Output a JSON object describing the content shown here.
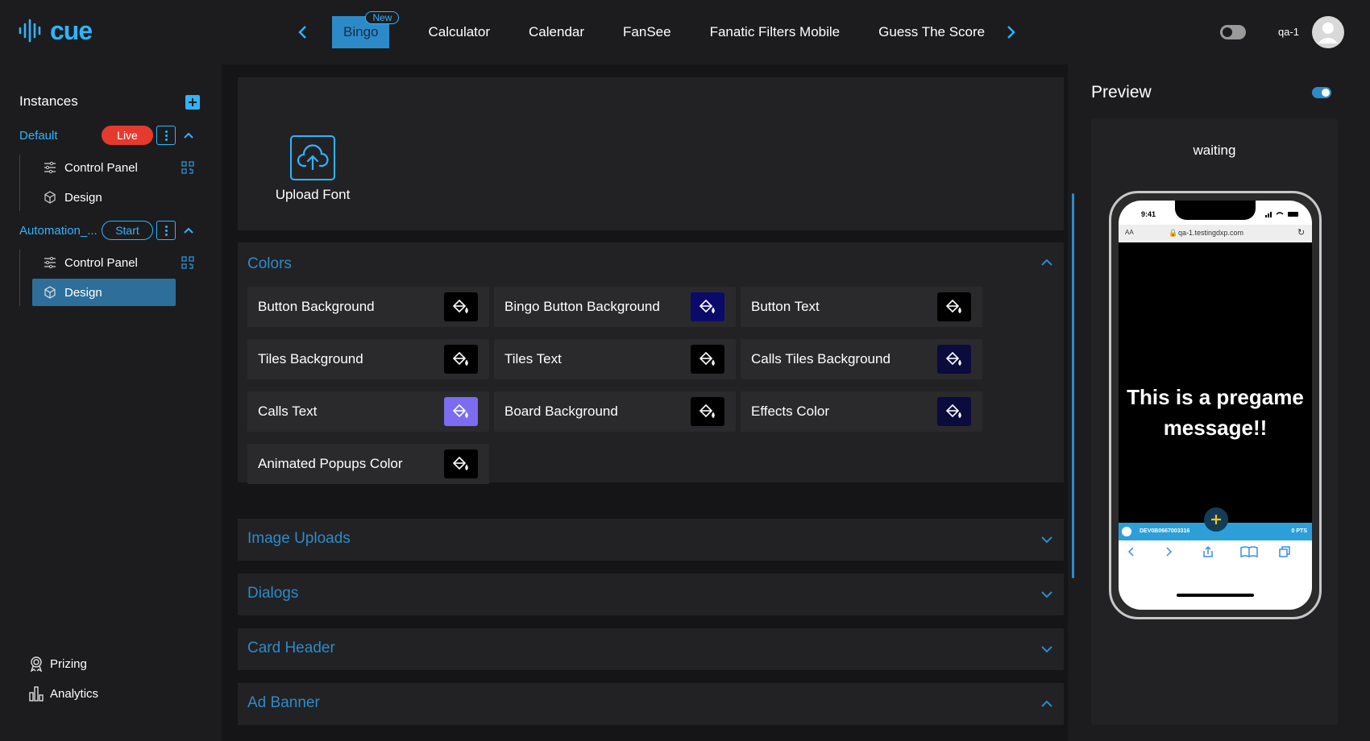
{
  "header": {
    "logo_text": "cue",
    "tabs": [
      {
        "label": "Bingo",
        "badge": "New",
        "active": true
      },
      {
        "label": "Calculator"
      },
      {
        "label": "Calendar"
      },
      {
        "label": "FanSee"
      },
      {
        "label": "Fanatic Filters Mobile"
      },
      {
        "label": "Guess The Score"
      }
    ],
    "username": "qa-1"
  },
  "sidebar": {
    "title": "Instances",
    "instances": [
      {
        "name": "Default",
        "status": "Live",
        "items": [
          "Control Panel",
          "Design"
        ]
      },
      {
        "name": "Automation_...",
        "status": "Start",
        "items": [
          "Control Panel",
          "Design"
        ]
      }
    ],
    "bottom": [
      "Prizing",
      "Analytics"
    ]
  },
  "upload": {
    "label": "Upload Font"
  },
  "colors": {
    "title": "Colors",
    "items": [
      {
        "label": "Button Background",
        "color": "#000000"
      },
      {
        "label": "Bingo Button Background",
        "color": "#0a0a6b"
      },
      {
        "label": "Button Text",
        "color": "#000000"
      },
      {
        "label": "Tiles Background",
        "color": "#000000"
      },
      {
        "label": "Tiles Text",
        "color": "#000000"
      },
      {
        "label": "Calls Tiles Background",
        "color": "#0b0b3d"
      },
      {
        "label": "Calls Text",
        "color": "#7b6cf0"
      },
      {
        "label": "Board Background",
        "color": "#000000"
      },
      {
        "label": "Effects Color",
        "color": "#0b0b3d"
      },
      {
        "label": "Animated Popups Color",
        "color": "#000000"
      }
    ]
  },
  "sections": [
    "Image Uploads",
    "Dialogs",
    "Card Header",
    "Ad Banner"
  ],
  "preview": {
    "title": "Preview",
    "status": "waiting",
    "phone_time": "9:41",
    "url_prefix": "AA",
    "url": "qa-1.testingdxp.com",
    "message": "This is a pregame message!!",
    "user_id": "DEV0B0667003316",
    "points": "0 PTS"
  },
  "theme": {
    "accent": "#2fb4ff",
    "live": "#e53a2e",
    "active_tab": "#2d8ac9"
  }
}
